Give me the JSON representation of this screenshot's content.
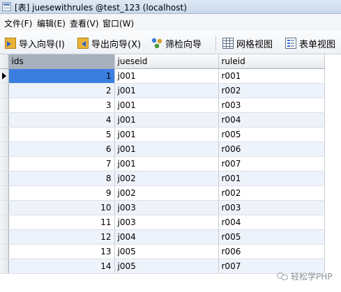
{
  "window": {
    "title": "[表] juesewithrules @test_123 (localhost)"
  },
  "menu": {
    "items": [
      {
        "label": "文件(F)"
      },
      {
        "label": "编辑(E)"
      },
      {
        "label": "查看(V)"
      },
      {
        "label": "窗口(W)"
      }
    ]
  },
  "toolbar": {
    "import_label": "导入向导(I)",
    "export_label": "导出向导(X)",
    "filter_label": "筛检向导",
    "grid_view_label": "网格视图",
    "form_view_label": "表单视图"
  },
  "table": {
    "columns": [
      "ids",
      "jueseid",
      "ruleid"
    ],
    "selected_column": "ids",
    "current_row": 1,
    "rows": [
      {
        "ids": "1",
        "jueseid": "j001",
        "ruleid": "r001"
      },
      {
        "ids": "2",
        "jueseid": "j001",
        "ruleid": "r002"
      },
      {
        "ids": "3",
        "jueseid": "j001",
        "ruleid": "r003"
      },
      {
        "ids": "4",
        "jueseid": "j001",
        "ruleid": "r004"
      },
      {
        "ids": "5",
        "jueseid": "j001",
        "ruleid": "r005"
      },
      {
        "ids": "6",
        "jueseid": "j001",
        "ruleid": "r006"
      },
      {
        "ids": "7",
        "jueseid": "j001",
        "ruleid": "r007"
      },
      {
        "ids": "8",
        "jueseid": "j002",
        "ruleid": "r001"
      },
      {
        "ids": "9",
        "jueseid": "j002",
        "ruleid": "r002"
      },
      {
        "ids": "10",
        "jueseid": "j003",
        "ruleid": "r003"
      },
      {
        "ids": "11",
        "jueseid": "j003",
        "ruleid": "r004"
      },
      {
        "ids": "12",
        "jueseid": "j004",
        "ruleid": "r005"
      },
      {
        "ids": "13",
        "jueseid": "j005",
        "ruleid": "r006"
      },
      {
        "ids": "14",
        "jueseid": "j005",
        "ruleid": "r007"
      }
    ]
  },
  "watermark": {
    "text": "轻松学PHP"
  },
  "colors": {
    "selection": "#3a7ee0",
    "alt_row": "#eef3fb",
    "header_selected": "#a8b0bb"
  }
}
